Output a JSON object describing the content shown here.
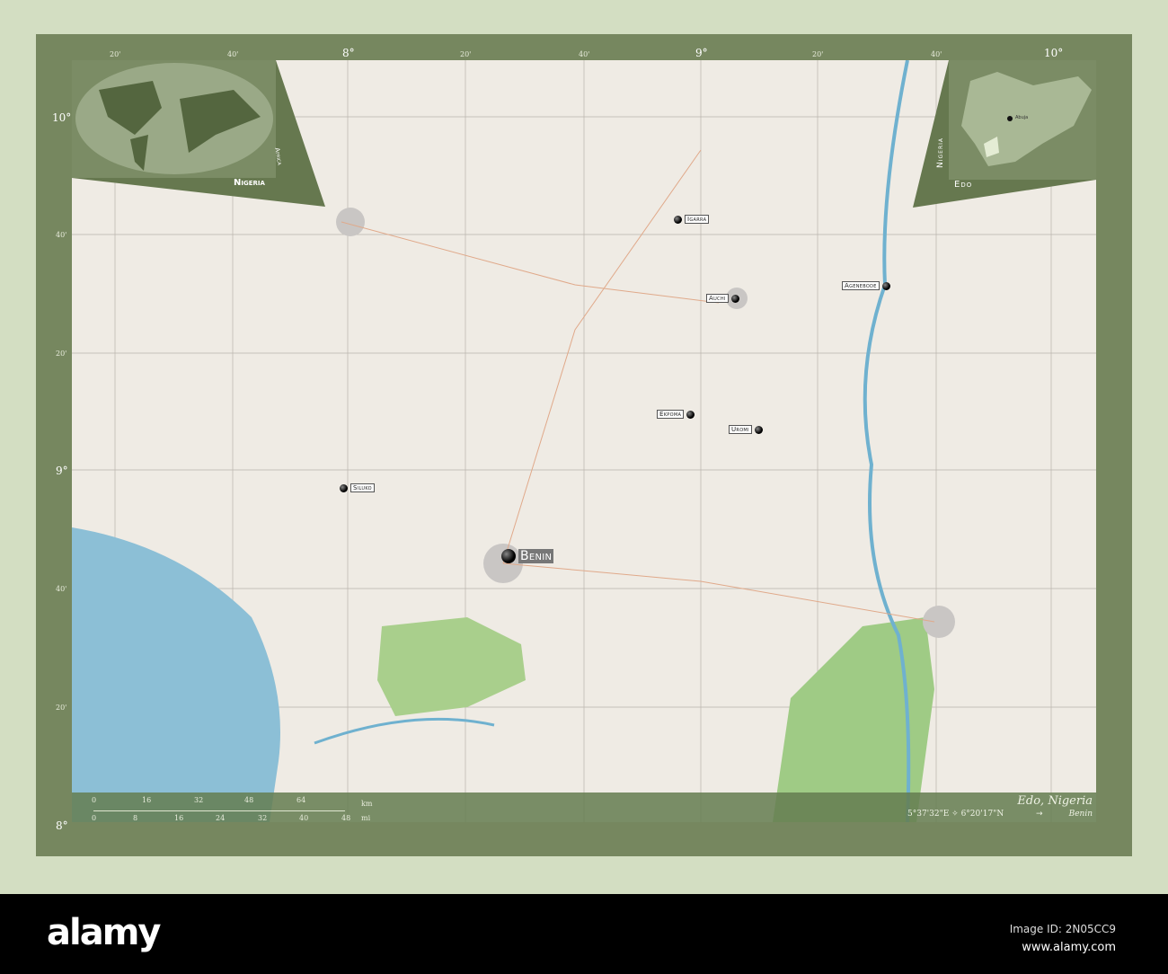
{
  "map": {
    "region_title": "Edo, Nigeria",
    "coordinates": "5°37'32\"E ✧ 6°20'17\"N",
    "arrow_to": "Benin",
    "inset_world_label": "Nigeria",
    "inset_world_sub": "Africa",
    "inset_country_label": "Nigeria",
    "inset_region_label": "Edo",
    "inset_capital": "Abuja"
  },
  "ticks": {
    "top": [
      "20'",
      "40'",
      "8°",
      "20'",
      "40'",
      "9°",
      "20'",
      "40'",
      "10°"
    ],
    "left": [
      "10°",
      "40'",
      "20'",
      "9°",
      "40'",
      "20'",
      "8°"
    ]
  },
  "cities": [
    {
      "name": "Igarra"
    },
    {
      "name": "Auchi"
    },
    {
      "name": "Agenebode"
    },
    {
      "name": "Ekpoma"
    },
    {
      "name": "Uromi"
    },
    {
      "name": "Siluko"
    },
    {
      "name": "Benin"
    }
  ],
  "scale": {
    "km_unit": "km",
    "mi_unit": "mi",
    "km": [
      "0",
      "16",
      "32",
      "48",
      "64"
    ],
    "mi": [
      "0",
      "8",
      "16",
      "24",
      "32",
      "40",
      "48"
    ]
  },
  "watermark": {
    "logo": "alamy",
    "image_id": "Image ID: 2N05CC9",
    "url": "www.alamy.com"
  }
}
